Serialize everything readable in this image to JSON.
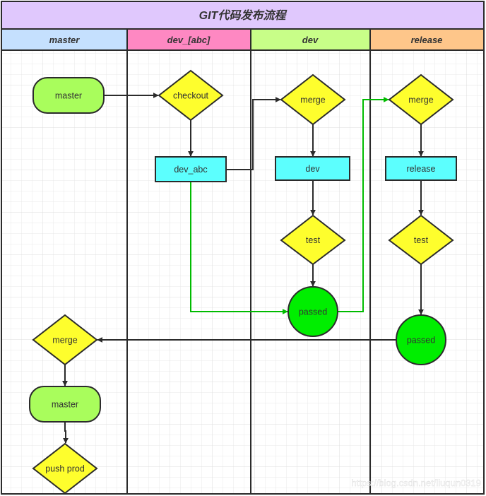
{
  "title": "GIT代码发布流程",
  "colors": {
    "title_bg": "#e0c8fd",
    "terminator_fill": "#a9fd5c",
    "decision_fill": "#fefe2d",
    "process_fill": "#5cfffe",
    "passed_fill": "#00ee00",
    "edge": "#2b2b2b",
    "edge_green": "#00bb00"
  },
  "lanes": [
    {
      "id": "master",
      "label": "master",
      "color": "#c5e0fe"
    },
    {
      "id": "dev_abc",
      "label": "dev_[abc]",
      "color": "#fe88c2"
    },
    {
      "id": "dev",
      "label": "dev",
      "color": "#c8fe88"
    },
    {
      "id": "release",
      "label": "release",
      "color": "#fec68a"
    }
  ],
  "nodes": [
    {
      "id": "n_master_start",
      "lane": "master",
      "shape": "terminator",
      "label": "master"
    },
    {
      "id": "n_checkout",
      "lane": "dev_abc",
      "shape": "decision",
      "label": "checkout"
    },
    {
      "id": "n_dev_abc",
      "lane": "dev_abc",
      "shape": "process",
      "label": "dev_abc"
    },
    {
      "id": "n_dev_merge",
      "lane": "dev",
      "shape": "decision",
      "label": "merge"
    },
    {
      "id": "n_dev",
      "lane": "dev",
      "shape": "process",
      "label": "dev"
    },
    {
      "id": "n_dev_test",
      "lane": "dev",
      "shape": "decision",
      "label": "test"
    },
    {
      "id": "n_dev_passed",
      "lane": "dev",
      "shape": "circle",
      "label": "passed"
    },
    {
      "id": "n_rel_merge",
      "lane": "release",
      "shape": "decision",
      "label": "merge"
    },
    {
      "id": "n_release",
      "lane": "release",
      "shape": "process",
      "label": "release"
    },
    {
      "id": "n_rel_test",
      "lane": "release",
      "shape": "decision",
      "label": "test"
    },
    {
      "id": "n_rel_passed",
      "lane": "release",
      "shape": "circle",
      "label": "passed"
    },
    {
      "id": "n_master_merge",
      "lane": "master",
      "shape": "decision",
      "label": "merge"
    },
    {
      "id": "n_master_end",
      "lane": "master",
      "shape": "terminator",
      "label": "master"
    },
    {
      "id": "n_push_prod",
      "lane": "master",
      "shape": "decision",
      "label": "push prod"
    }
  ],
  "edges": [
    {
      "from": "n_master_start",
      "to": "n_checkout",
      "color": "black"
    },
    {
      "from": "n_checkout",
      "to": "n_dev_abc",
      "color": "black"
    },
    {
      "from": "n_dev_abc",
      "to": "n_dev_merge",
      "color": "black"
    },
    {
      "from": "n_dev_merge",
      "to": "n_dev",
      "color": "black"
    },
    {
      "from": "n_dev",
      "to": "n_dev_test",
      "color": "black"
    },
    {
      "from": "n_dev_test",
      "to": "n_dev_passed",
      "color": "black"
    },
    {
      "from": "n_dev_abc",
      "to": "n_dev_passed",
      "color": "green"
    },
    {
      "from": "n_dev_passed",
      "to": "n_rel_merge",
      "color": "green"
    },
    {
      "from": "n_rel_merge",
      "to": "n_release",
      "color": "black"
    },
    {
      "from": "n_release",
      "to": "n_rel_test",
      "color": "black"
    },
    {
      "from": "n_rel_test",
      "to": "n_rel_passed",
      "color": "black"
    },
    {
      "from": "n_rel_passed",
      "to": "n_master_merge",
      "color": "black"
    },
    {
      "from": "n_master_merge",
      "to": "n_master_end",
      "color": "black"
    },
    {
      "from": "n_master_end",
      "to": "n_push_prod",
      "color": "black"
    }
  ],
  "watermark": "https://blog.csdn.net/liuqun0319"
}
